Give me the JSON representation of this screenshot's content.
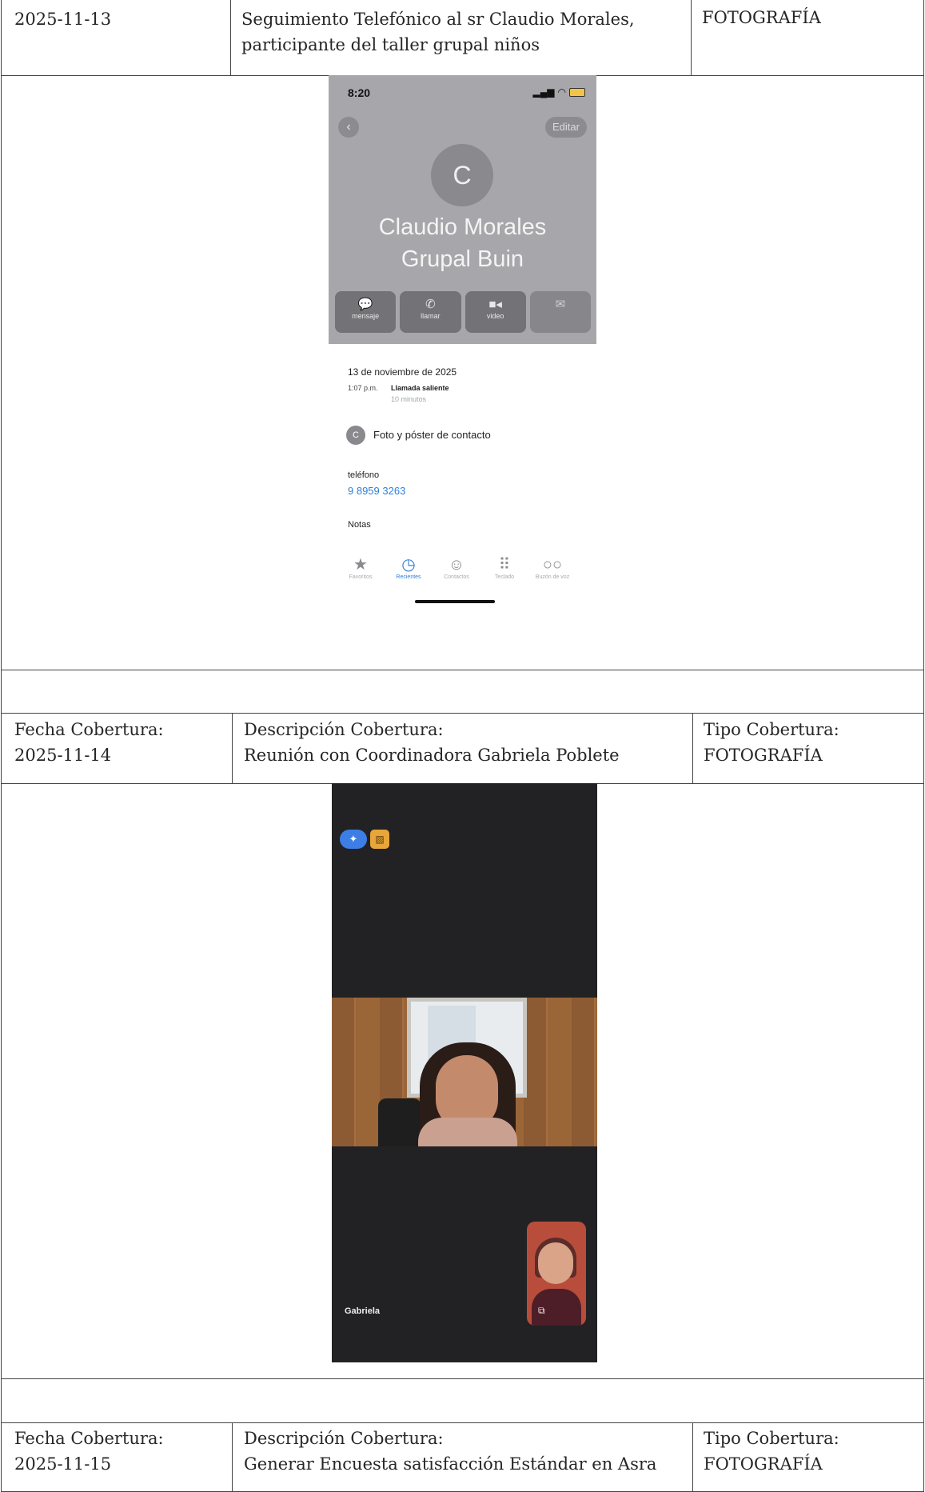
{
  "row1": {
    "date": "2025-11-13",
    "description_line1": "Seguimiento Telefónico al sr Claudio Morales,",
    "description_line2": "participante del taller grupal niños",
    "type": "FOTOGRAFÍA"
  },
  "phone_contact": {
    "status_time": "8:20",
    "edit_label": "Editar",
    "avatar_letter": "C",
    "name_line1": "Claudio Morales",
    "name_line2": "Grupal Buin",
    "actions": [
      {
        "label": "mensaje",
        "icon": "message-icon"
      },
      {
        "label": "llamar",
        "icon": "phone-icon"
      },
      {
        "label": "video",
        "icon": "video-icon"
      },
      {
        "label": "",
        "icon": "mail-icon"
      }
    ],
    "call_date": "13 de noviembre de 2025",
    "call_time": "1:07 p.m.",
    "call_type": "Llamada saliente",
    "call_duration": "10 minutos",
    "contact_photo_label": "Foto y póster de contacto",
    "phone_label": "teléfono",
    "phone_number": "9 8959 3263",
    "notes_label": "Notas",
    "tabs": [
      {
        "label": "Favoritos",
        "icon": "star-icon"
      },
      {
        "label": "Recientes",
        "icon": "clock-icon"
      },
      {
        "label": "Contactos",
        "icon": "person-icon"
      },
      {
        "label": "Teclado",
        "icon": "keypad-icon"
      },
      {
        "label": "Buzón de voz",
        "icon": "voicemail-icon"
      }
    ]
  },
  "row2": {
    "date_label": "Fecha Cobertura:",
    "date": "2025-11-14",
    "description_label": "Descripción Cobertura:",
    "description": "Reunión con Coordinadora Gabriela Poblete",
    "type_label": "Tipo Cobertura:",
    "type": "FOTOGRAFÍA"
  },
  "video_call": {
    "callee_name": "Gabriela"
  },
  "row3": {
    "date_label": "Fecha Cobertura:",
    "date": "2025-11-15",
    "description_label": "Descripción Cobertura:",
    "description": "Generar Encuesta satisfacción Estándar en Asra",
    "type_label": "Tipo Cobertura:",
    "type": "FOTOGRAFÍA"
  }
}
